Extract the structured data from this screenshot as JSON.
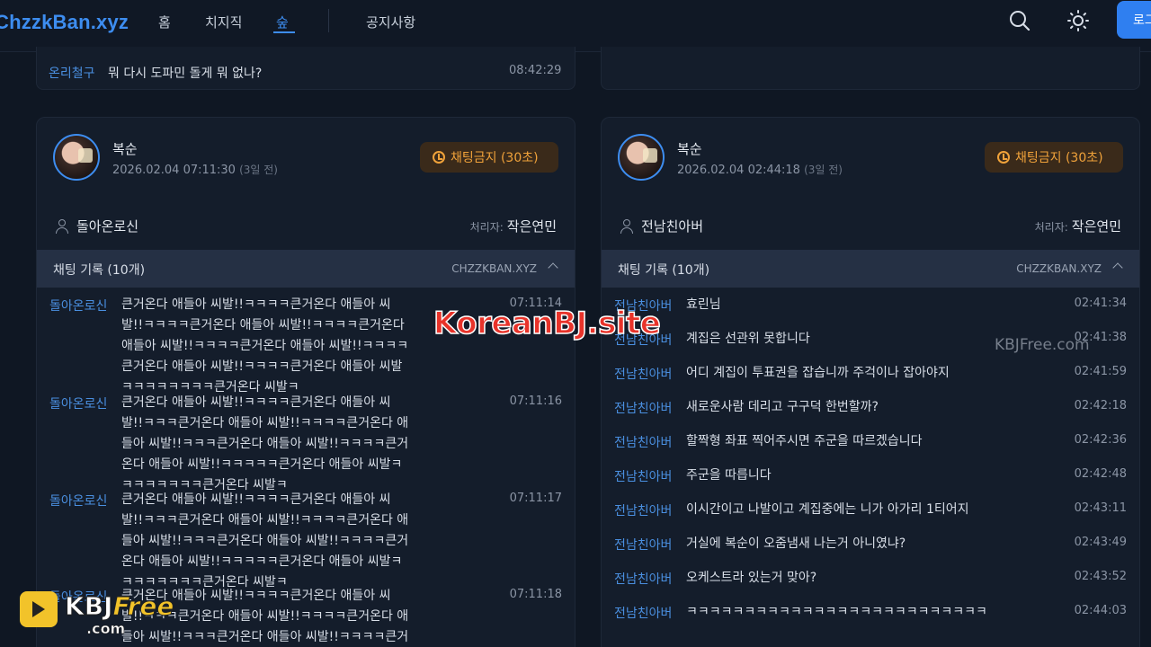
{
  "nav": {
    "brand": "ChzzkBan.xyz",
    "links": [
      "홈",
      "치지직",
      "숲",
      "공지사항"
    ],
    "login_label": "로그"
  },
  "top_row": {
    "user": "온리철구",
    "text": "뭐 다시 도파민 돌게 뭐 없나?",
    "time": "08:42:29"
  },
  "cards": [
    {
      "streamer": "복순",
      "date": "2026.02.04 07:11:30",
      "ago": "(3일 전)",
      "badge": "채팅금지 (30초)",
      "target": "돌아온로신",
      "handler_label": "처리자:",
      "handler": "작은연민",
      "log_title": "채팅 기록 (10개)",
      "log_source": "CHZZKBAN.XYZ",
      "messages": [
        {
          "user": "돌아온로신",
          "text": "큰거온다 애들아 씨발!!ㅋㅋㅋㅋ큰거온다 애들아 씨발!!ㅋㅋㅋㅋ큰거온다 애들아 씨발!!ㅋㅋㅋㅋ큰거온다 애들아 씨발!!ㅋㅋㅋㅋ큰거온다 애들아 씨발!!ㅋㅋㅋㅋ큰거온다 애들아 씨발!!ㅋㅋㅋㅋ큰거온다 애들아 씨발ㅋㅋㅋㅋㅋㅋㅋㅋ큰거온다 씨발ㅋ",
          "time": "07:11:14"
        },
        {
          "user": "돌아온로신",
          "text": "큰거온다 애들아 씨발!!ㅋㅋㅋㅋ큰거온다 애들아 씨발!!ㅋㅋㅋ큰거온다 애들아 씨발!!ㅋㅋㅋㅋ큰거온다 애들아 씨발!!ㅋㅋㅋ큰거온다 애들아 씨발!!ㅋㅋㅋㅋ큰거온다 애들아 씨발!!ㅋㅋㅋㅋㅋ큰거온다 애들아 씨발ㅋㅋㅋㅋㅋㅋㅋㅋ큰거온다 씨발ㅋ",
          "time": "07:11:16"
        },
        {
          "user": "돌아온로신",
          "text": "큰거온다 애들아 씨발!!ㅋㅋㅋㅋ큰거온다 애들아 씨발!!ㅋㅋㅋ큰거온다 애들아 씨발!!ㅋㅋㅋㅋ큰거온다 애들아 씨발!!ㅋㅋㅋ큰거온다 애들아 씨발!!ㅋㅋㅋㅋ큰거온다 애들아 씨발!!ㅋㅋㅋㅋㅋ큰거온다 애들아 씨발ㅋㅋㅋㅋㅋㅋㅋㅋ큰거온다 씨발ㅋ",
          "time": "07:11:17"
        },
        {
          "user": "돌아온로신",
          "text": "큰거온다 애들아 씨발!!ㅋㅋㅋㅋ큰거온다 애들아 씨발!!ㅋㅋㅋ큰거온다 애들아 씨발!!ㅋㅋㅋㅋ큰거온다 애들아 씨발!!ㅋㅋㅋ큰거온다 애들아 씨발!!ㅋㅋㅋㅋ큰거온다 애들아 씨발!!ㅋㅋㅋㅋㅋ큰거온다",
          "time": "07:11:18"
        }
      ]
    },
    {
      "streamer": "복순",
      "date": "2026.02.04 02:44:18",
      "ago": "(3일 전)",
      "badge": "채팅금지 (30초)",
      "target": "전남친아버",
      "handler_label": "처리자:",
      "handler": "작은연민",
      "log_title": "채팅 기록 (10개)",
      "log_source": "CHZZKBAN.XYZ",
      "messages": [
        {
          "user": "전남친아버",
          "text": "효린님",
          "time": "02:41:34"
        },
        {
          "user": "전남친아버",
          "text": "계집은 선관위 못합니다",
          "time": "02:41:38"
        },
        {
          "user": "전남친아버",
          "text": "어디 계집이 투표권을 잡습니까 주걱이나 잡아야지",
          "time": "02:41:59"
        },
        {
          "user": "전남친아버",
          "text": "새로운사람 데리고 구구덕 한번할까?",
          "time": "02:42:18"
        },
        {
          "user": "전남친아버",
          "text": "할짝형 좌표 찍어주시면 주군을 따르겠습니다",
          "time": "02:42:36"
        },
        {
          "user": "전남친아버",
          "text": "주군을 따릅니다",
          "time": "02:42:48"
        },
        {
          "user": "전남친아버",
          "text": "이시간이고 나발이고 계집중에는 니가 아가리 1티어지",
          "time": "02:43:11"
        },
        {
          "user": "전남친아버",
          "text": "거실에 복순이 오줌냄새 나는거 아니였냐?",
          "time": "02:43:49"
        },
        {
          "user": "전남친아버",
          "text": "오케스트라 있는거 맞아?",
          "time": "02:43:52"
        },
        {
          "user": "전남친아버",
          "text": "ㅋㅋㅋㅋㅋㅋㅋㅋㅋㅋㅋㅋㅋㅋㅋㅋㅋㅋㅋㅋㅋㅋㅋㅋㅋㅋ",
          "time": "02:44:03"
        }
      ]
    }
  ],
  "watermarks": {
    "main": "KoreanBJ.site",
    "side": "KBJFree.com",
    "logo_kbj": "KBJ",
    "logo_free": "Free",
    "logo_com": ".com"
  },
  "colors": {
    "accent": "#3d8df0",
    "ban": "#f0a23a",
    "bg": "#0f1723",
    "card": "#141d2b"
  }
}
